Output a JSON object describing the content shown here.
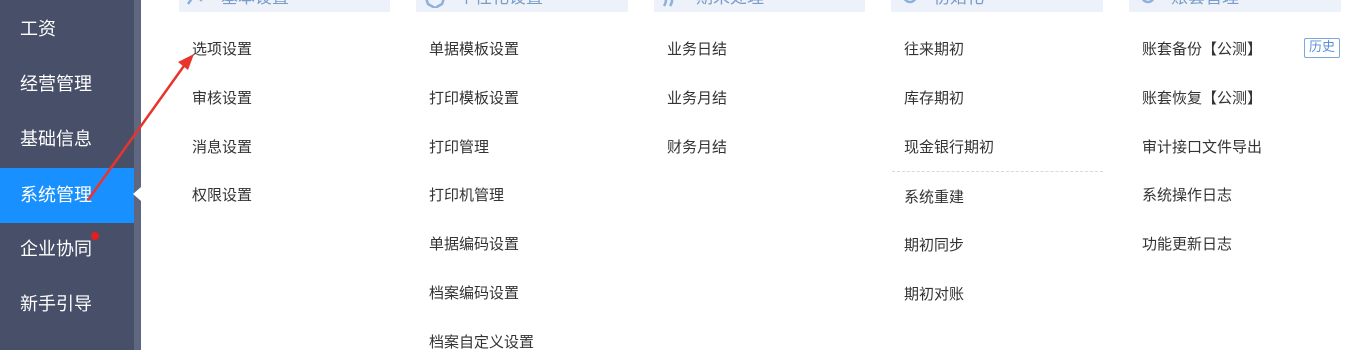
{
  "sidebar": {
    "items": [
      {
        "label": "工资"
      },
      {
        "label": "经营管理"
      },
      {
        "label": "基础信息"
      },
      {
        "label": "系统管理"
      },
      {
        "label": "企业协同"
      },
      {
        "label": "新手引导"
      }
    ],
    "active_index": 3
  },
  "columns": [
    {
      "header": "基本设置",
      "icon": "settings-icon",
      "items": [
        "选项设置",
        "审核设置",
        "消息设置",
        "权限设置"
      ]
    },
    {
      "header": "个性化设置",
      "icon": "bubble-icon",
      "items": [
        "单据模板设置",
        "打印模板设置",
        "打印管理",
        "打印机管理",
        "单据编码设置",
        "档案编码设置",
        "档案自定义设置"
      ]
    },
    {
      "header": "期末处理",
      "icon": "cycle-icon",
      "items": [
        "业务日结",
        "业务月结",
        "财务月结"
      ]
    },
    {
      "header": "初始化",
      "icon": "gear-icon",
      "items": [
        "往来期初",
        "库存期初",
        "现金银行期初",
        "系统重建",
        "期初同步",
        "期初对账"
      ]
    },
    {
      "header": "账套管理",
      "icon": "gear-icon",
      "items": [
        "账套备份【公测】",
        "账套恢复【公测】",
        "审计接口文件导出",
        "系统操作日志",
        "功能更新日志"
      ]
    }
  ],
  "history_badge": "历史",
  "colors": {
    "sidebar_bg": "#485069",
    "active": "#1890ff",
    "header_bg": "#edf2fa",
    "header_text": "#7a9cc9",
    "arrow": "#e8342c",
    "badge_dot": "#e61e1e"
  }
}
